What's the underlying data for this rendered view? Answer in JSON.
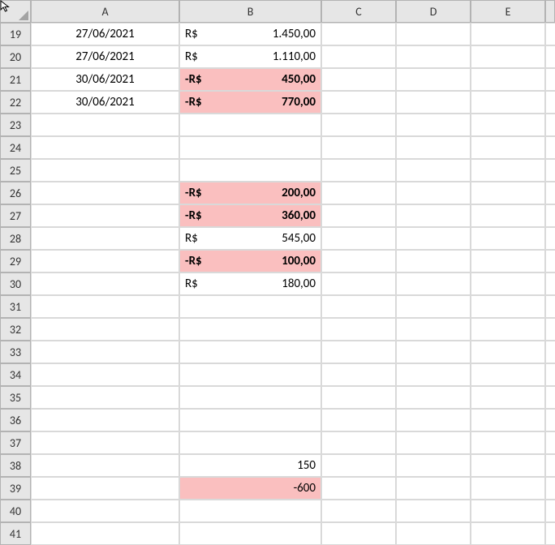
{
  "columns": [
    "A",
    "B",
    "C",
    "D",
    "E",
    ""
  ],
  "rowStart": 19,
  "rowEnd": 41,
  "rows": [
    {
      "r": 19,
      "A": "27/06/2021",
      "B": {
        "prefix": "R$",
        "val": "1.450,00",
        "hl": false,
        "bold": false
      }
    },
    {
      "r": 20,
      "A": "27/06/2021",
      "B": {
        "prefix": "R$",
        "val": "1.110,00",
        "hl": false,
        "bold": false
      }
    },
    {
      "r": 21,
      "A": "30/06/2021",
      "B": {
        "prefix": "-R$",
        "val": "450,00",
        "hl": true,
        "bold": true
      }
    },
    {
      "r": 22,
      "A": "30/06/2021",
      "B": {
        "prefix": "-R$",
        "val": "770,00",
        "hl": true,
        "bold": true
      }
    },
    {
      "r": 23
    },
    {
      "r": 24
    },
    {
      "r": 25
    },
    {
      "r": 26,
      "B": {
        "prefix": "-R$",
        "val": "200,00",
        "hl": true,
        "bold": true
      }
    },
    {
      "r": 27,
      "B": {
        "prefix": "-R$",
        "val": "360,00",
        "hl": true,
        "bold": true
      }
    },
    {
      "r": 28,
      "B": {
        "prefix": "R$",
        "val": "545,00",
        "hl": false,
        "bold": false
      }
    },
    {
      "r": 29,
      "B": {
        "prefix": "-R$",
        "val": "100,00",
        "hl": true,
        "bold": true
      }
    },
    {
      "r": 30,
      "B": {
        "prefix": "R$",
        "val": "180,00",
        "hl": false,
        "bold": false
      }
    },
    {
      "r": 31
    },
    {
      "r": 32
    },
    {
      "r": 33
    },
    {
      "r": 34
    },
    {
      "r": 35
    },
    {
      "r": 36
    },
    {
      "r": 37
    },
    {
      "r": 38,
      "B": {
        "plain": "150",
        "hl": false,
        "bold": false
      }
    },
    {
      "r": 39,
      "B": {
        "plain": "-600",
        "hl": true,
        "bold": false
      }
    },
    {
      "r": 40
    },
    {
      "r": 41
    }
  ]
}
